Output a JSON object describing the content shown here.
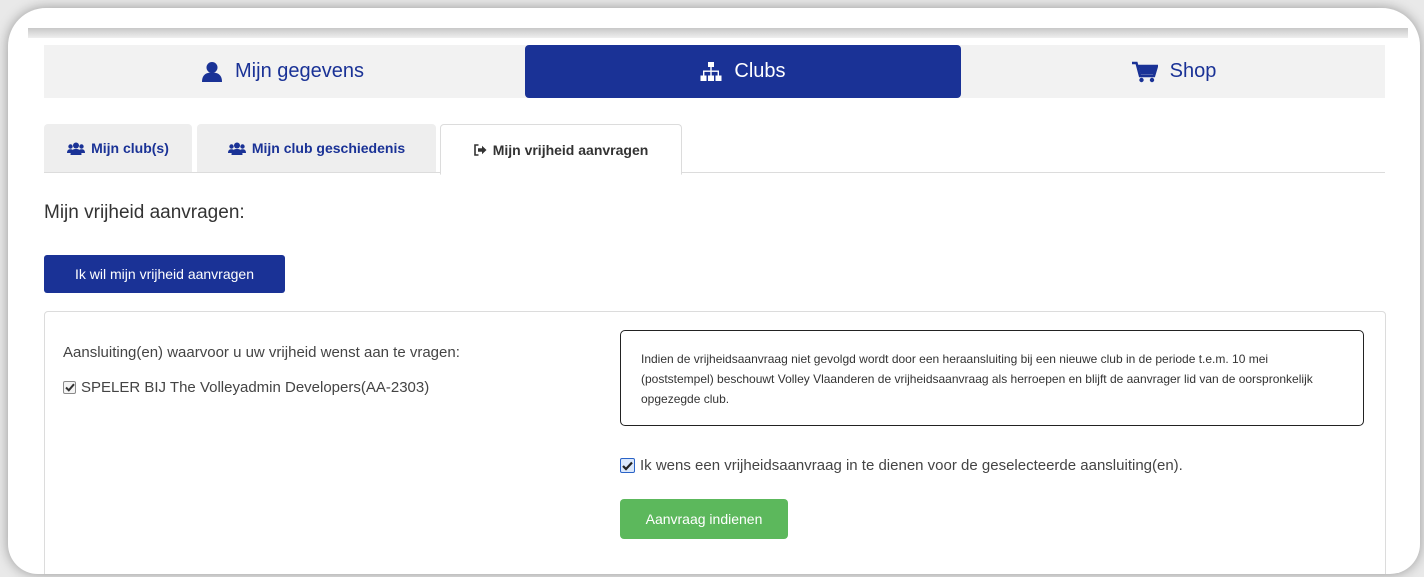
{
  "main_nav": {
    "items": [
      {
        "label": "Mijn gegevens",
        "icon": "user-icon"
      },
      {
        "label": "Clubs",
        "icon": "sitemap-icon"
      },
      {
        "label": "Shop",
        "icon": "cart-icon"
      }
    ],
    "active_index": 1,
    "accent": "#1a3296"
  },
  "tabs": [
    {
      "label": "Mijn club(s)",
      "icon": "users-icon"
    },
    {
      "label": "Mijn club geschiedenis",
      "icon": "users-icon"
    },
    {
      "label": "Mijn vrijheid aanvragen",
      "icon": "sign-out-icon"
    }
  ],
  "active_tab_index": 2,
  "page": {
    "title": "Mijn vrijheid aanvragen:",
    "request_button": "Ik wil mijn vrijheid aanvragen"
  },
  "form": {
    "selection_label": "Aansluiting(en) waarvoor u uw vrijheid wenst aan te vragen:",
    "affiliations": [
      {
        "label": "SPELER BIJ The Volleyadmin Developers(AA-2303)",
        "checked": true
      }
    ],
    "info_text": "Indien de vrijheidsaanvraag niet gevolgd wordt door een heraansluiting bij een nieuwe club in de periode t.e.m. 10 mei (poststempel) beschouwt Volley Vlaanderen de vrijheidsaanvraag als herroepen en blijft de aanvrager lid van de oorspronkelijk opgezegde club.",
    "confirm_label": "Ik wens een vrijheidsaanvraag in te dienen voor de geselecteerde aansluiting(en).",
    "confirm_checked": true,
    "submit_button": "Aanvraag indienen",
    "submit_color": "#5cb85c"
  }
}
